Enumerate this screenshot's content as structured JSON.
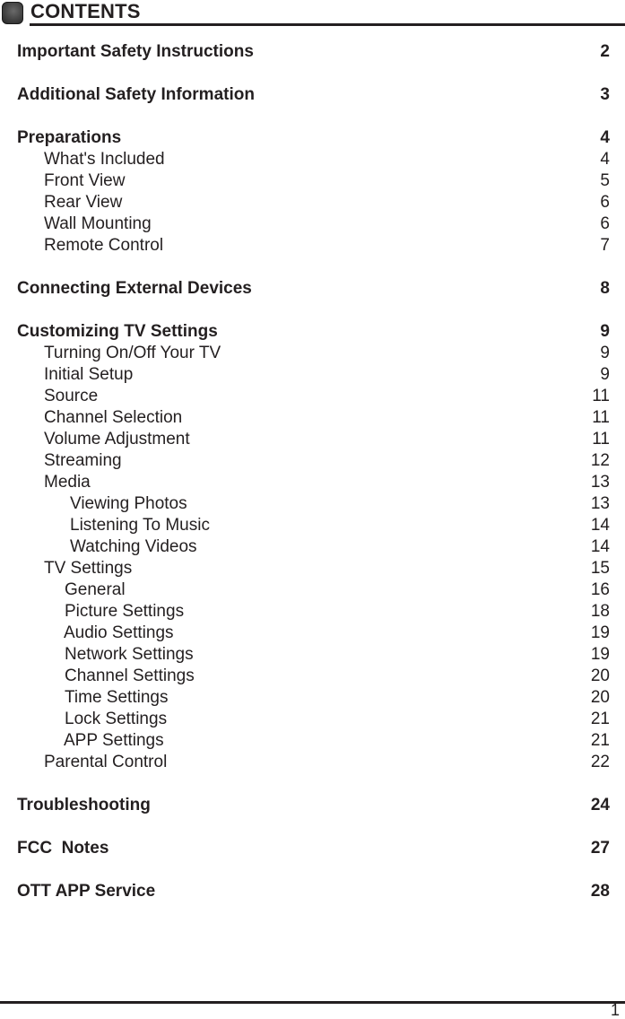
{
  "header": {
    "title": "CONTENTS",
    "badge_icon": "rounded-square-bullet-icon"
  },
  "toc": [
    {
      "label": "Important Safety Instructions",
      "page": "2",
      "level": 0
    },
    {
      "label": "Additional Safety Information",
      "page": "3",
      "level": 0
    },
    {
      "label": "Preparations",
      "page": "4",
      "level": 0
    },
    {
      "label": "What's Included",
      "page": "4",
      "level": 1
    },
    {
      "label": "Front View",
      "page": "5",
      "level": 1
    },
    {
      "label": "Rear View",
      "page": "6",
      "level": 1
    },
    {
      "label": "Wall Mounting",
      "page": "6",
      "level": 1
    },
    {
      "label": "Remote Control",
      "page": "7",
      "level": 1
    },
    {
      "label": "Connecting External Devices",
      "page": "8",
      "level": 0
    },
    {
      "label": "Customizing TV Settings",
      "page": "9",
      "level": 0
    },
    {
      "label": "Turning On/Off Your TV",
      "page": "9",
      "level": 1
    },
    {
      "label": "Initial Setup",
      "page": "9",
      "level": 1
    },
    {
      "label": "Source",
      "page": "11",
      "level": 1
    },
    {
      "label": "Channel Selection",
      "page": "11",
      "level": 1
    },
    {
      "label": "Volume Adjustment",
      "page": "11",
      "level": 1
    },
    {
      "label": "Streaming",
      "page": "12",
      "level": 1
    },
    {
      "label": "Media",
      "page": "13",
      "level": 1
    },
    {
      "label": "Viewing Photos",
      "page": "13",
      "level": 3
    },
    {
      "label": "Listening To Music",
      "page": "14",
      "level": 3
    },
    {
      "label": "Watching Videos",
      "page": "14",
      "level": 3
    },
    {
      "label": "TV Settings",
      "page": "15",
      "level": 1
    },
    {
      "label": "General",
      "page": "16",
      "level": 2
    },
    {
      "label": "Picture Settings",
      "page": "18",
      "level": 2
    },
    {
      "label": "Audio Settings",
      "page": "19",
      "level": 2
    },
    {
      "label": "Network Settings",
      "page": "19",
      "level": 2
    },
    {
      "label": "Channel Settings",
      "page": "20",
      "level": 2
    },
    {
      "label": "Time Settings",
      "page": "20",
      "level": 2
    },
    {
      "label": "Lock Settings",
      "page": "21",
      "level": 2
    },
    {
      "label": "APP Settings",
      "page": "21",
      "level": 2
    },
    {
      "label": "Parental Control",
      "page": "22",
      "level": 1
    },
    {
      "label": "Troubleshooting",
      "page": "24",
      "level": 0
    },
    {
      "label": "FCC  Notes",
      "page": "27",
      "level": 0
    },
    {
      "label": "OTT APP Service",
      "page": "28",
      "level": 0
    }
  ],
  "footer": {
    "page_number": "1"
  }
}
